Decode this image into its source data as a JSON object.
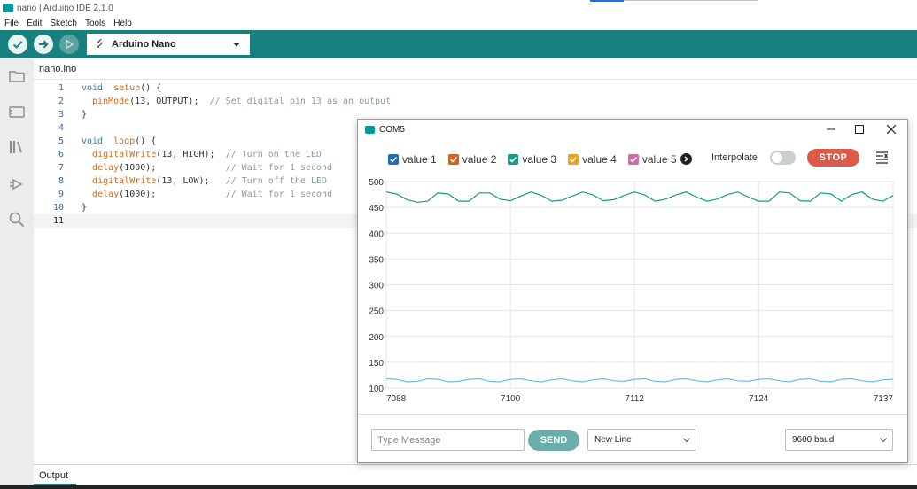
{
  "window": {
    "title": "nano | Arduino IDE 2.1.0"
  },
  "menu": [
    "File",
    "Edit",
    "Sketch",
    "Tools",
    "Help"
  ],
  "toolbar": {
    "board": "Arduino Nano"
  },
  "editor": {
    "tab": "nano.ino",
    "lines": [
      {
        "n": "1",
        "parts": [
          [
            "kw",
            "void"
          ],
          [
            "",
            "  "
          ],
          [
            "fn",
            "setup"
          ],
          [
            "",
            "() {"
          ]
        ]
      },
      {
        "n": "2",
        "parts": [
          [
            "",
            "  "
          ],
          [
            "fn",
            "pinMode"
          ],
          [
            "",
            "(13, OUTPUT);  "
          ],
          [
            "cm",
            "// Set digital pin 13 as an output"
          ]
        ]
      },
      {
        "n": "3",
        "parts": [
          [
            "",
            "}"
          ]
        ]
      },
      {
        "n": "4",
        "parts": []
      },
      {
        "n": "5",
        "parts": [
          [
            "kw",
            "void"
          ],
          [
            "",
            "  "
          ],
          [
            "fn",
            "loop"
          ],
          [
            "",
            "() {"
          ]
        ]
      },
      {
        "n": "6",
        "parts": [
          [
            "",
            "  "
          ],
          [
            "fn",
            "digitalWrite"
          ],
          [
            "",
            "(13, HIGH);  "
          ],
          [
            "cm",
            "// Turn on the LED"
          ]
        ]
      },
      {
        "n": "7",
        "parts": [
          [
            "",
            "  "
          ],
          [
            "fn",
            "delay"
          ],
          [
            "",
            "(1000);             "
          ],
          [
            "cm",
            "// Wait for 1 second"
          ]
        ]
      },
      {
        "n": "8",
        "parts": [
          [
            "",
            "  "
          ],
          [
            "fn",
            "digitalWrite"
          ],
          [
            "",
            "(13, LOW);   "
          ],
          [
            "cm",
            "// Turn off the LED"
          ]
        ]
      },
      {
        "n": "9",
        "parts": [
          [
            "",
            "  "
          ],
          [
            "fn",
            "delay"
          ],
          [
            "",
            "(1000);             "
          ],
          [
            "cm",
            "// Wait for 1 second"
          ]
        ]
      },
      {
        "n": "10",
        "parts": [
          [
            "",
            "}"
          ]
        ]
      },
      {
        "n": "11",
        "parts": []
      }
    ]
  },
  "output": {
    "tab": "Output"
  },
  "plotter": {
    "title": "COM5",
    "legend": [
      {
        "label": "value 1",
        "color": "#1f6fb5"
      },
      {
        "label": "value 2",
        "color": "#d4631e"
      },
      {
        "label": "value 3",
        "color": "#179a84"
      },
      {
        "label": "value 4",
        "color": "#e8a21c"
      },
      {
        "label": "value 5",
        "color": "#d06ba9"
      }
    ],
    "interpolate_label": "Interpolate",
    "stop_label": "STOP",
    "message_placeholder": "Type Message",
    "send_label": "SEND",
    "line_ending": "New Line",
    "baud": "9600 baud"
  },
  "chart_data": {
    "type": "line",
    "xlim": [
      7088,
      7137
    ],
    "ylim": [
      100,
      500
    ],
    "xticks": [
      7088,
      7100,
      7112,
      7124,
      7137
    ],
    "yticks": [
      100,
      150,
      200,
      250,
      300,
      350,
      400,
      450,
      500
    ],
    "grid": true,
    "series": [
      {
        "color": "#179a84",
        "x": [
          7088,
          7089,
          7090,
          7091,
          7092,
          7093,
          7094,
          7095,
          7096,
          7097,
          7098,
          7099,
          7100,
          7101,
          7102,
          7103,
          7104,
          7105,
          7106,
          7107,
          7108,
          7109,
          7110,
          7111,
          7112,
          7113,
          7114,
          7115,
          7116,
          7117,
          7118,
          7119,
          7120,
          7121,
          7122,
          7123,
          7124,
          7125,
          7126,
          7127,
          7128,
          7129,
          7130,
          7131,
          7132,
          7133,
          7134,
          7135,
          7136,
          7137
        ],
        "values": [
          480,
          476,
          465,
          460,
          462,
          478,
          476,
          462,
          462,
          478,
          478,
          466,
          463,
          472,
          480,
          473,
          462,
          464,
          472,
          480,
          474,
          463,
          465,
          473,
          480,
          474,
          462,
          466,
          474,
          480,
          470,
          462,
          466,
          475,
          480,
          470,
          462,
          462,
          480,
          478,
          463,
          462,
          478,
          476,
          462,
          475,
          480,
          466,
          462,
          473
        ]
      },
      {
        "color": "#6cc1da",
        "x": [
          7088,
          7089,
          7090,
          7091,
          7092,
          7093,
          7094,
          7095,
          7096,
          7097,
          7098,
          7099,
          7100,
          7101,
          7102,
          7103,
          7104,
          7105,
          7106,
          7107,
          7108,
          7109,
          7110,
          7111,
          7112,
          7113,
          7114,
          7115,
          7116,
          7117,
          7118,
          7119,
          7120,
          7121,
          7122,
          7123,
          7124,
          7125,
          7126,
          7127,
          7128,
          7129,
          7130,
          7131,
          7132,
          7133,
          7134,
          7135,
          7136,
          7137
        ],
        "values": [
          118,
          117,
          112,
          113,
          118,
          117,
          112,
          113,
          117,
          118,
          113,
          112,
          117,
          118,
          114,
          112,
          116,
          118,
          114,
          112,
          116,
          118,
          114,
          113,
          117,
          118,
          113,
          112,
          117,
          118,
          114,
          112,
          116,
          118,
          114,
          113,
          117,
          118,
          114,
          112,
          117,
          118,
          113,
          112,
          117,
          118,
          114,
          112,
          116,
          117
        ]
      }
    ]
  }
}
